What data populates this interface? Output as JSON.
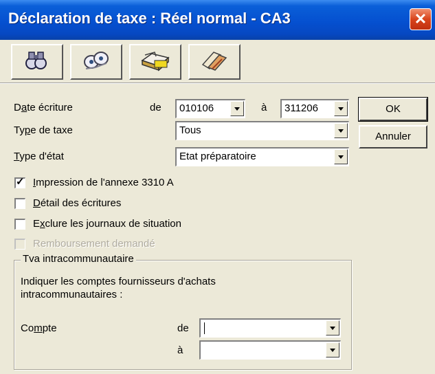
{
  "window": {
    "title": "Déclaration de taxe : Réel normal - CA3",
    "close_symbol": "✕"
  },
  "toolbar": {
    "buttons": [
      {
        "icon": "binoculars-icon"
      },
      {
        "icon": "eye-glasses-icon"
      },
      {
        "icon": "printer-icon"
      },
      {
        "icon": "export-icon"
      }
    ]
  },
  "form": {
    "date": {
      "label_pre": "D",
      "label_accel": "a",
      "label_post": "te écriture",
      "from_label": "de",
      "from_value": "010106",
      "to_label": "à",
      "to_value": "311206"
    },
    "type_taxe": {
      "label_pre": "Ty",
      "label_accel": "p",
      "label_post": "e de taxe",
      "value": "Tous"
    },
    "type_etat": {
      "label_pre": "",
      "label_accel": "T",
      "label_post": "ype d'état",
      "value": "Etat préparatoire"
    },
    "checkboxes": [
      {
        "pre": "",
        "accel": "I",
        "post": "mpression de l'annexe 3310 A",
        "checked": true,
        "enabled": true
      },
      {
        "pre": "",
        "accel": "D",
        "post": "étail des écritures",
        "checked": false,
        "enabled": true
      },
      {
        "pre": "E",
        "accel": "x",
        "post": "clure les journaux de situation",
        "checked": false,
        "enabled": true
      },
      {
        "pre": "",
        "accel": "",
        "post": "Remboursement demandé",
        "checked": false,
        "enabled": false
      }
    ],
    "tva_group": {
      "title": "Tva intracommunautaire",
      "description_line1": "Indiquer les comptes fournisseurs d'achats",
      "description_line2": "intracommunautaires :",
      "compte_label_pre": "Co",
      "compte_label_accel": "m",
      "compte_label_post": "pte",
      "from_label": "de",
      "from_value": "",
      "to_label": "à",
      "to_value": ""
    }
  },
  "buttons": {
    "ok": "OK",
    "cancel": "Annuler"
  }
}
